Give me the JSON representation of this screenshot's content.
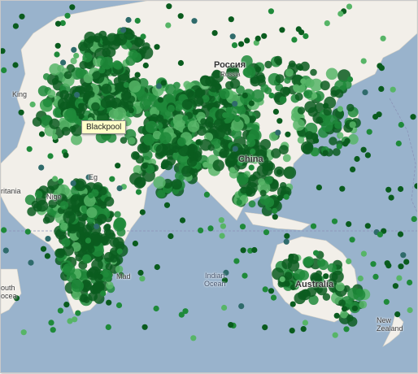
{
  "map": {
    "colors": {
      "water": "#99b3cc",
      "land": "#f2efe9",
      "dense": "#0a5c1e",
      "mid": "#1f8a3a",
      "light": "#57b567",
      "coast": "#2f6b6b"
    }
  },
  "tooltip": {
    "label": "Blackpool"
  },
  "labels": {
    "russia": "Россия",
    "russia_sub": "Russia",
    "china": "China",
    "australia": "Australia",
    "indian_ocean": "Indian",
    "indian_ocean2": "Ocean",
    "new_zealand": "New",
    "new_zealand2": "Zealand",
    "south": "outh",
    "south2": "ocea",
    "mauritania": "ritania",
    "kingdom": "King",
    "ne": "Nige",
    "madagascar": "Mad",
    "egypt": "Eg"
  }
}
